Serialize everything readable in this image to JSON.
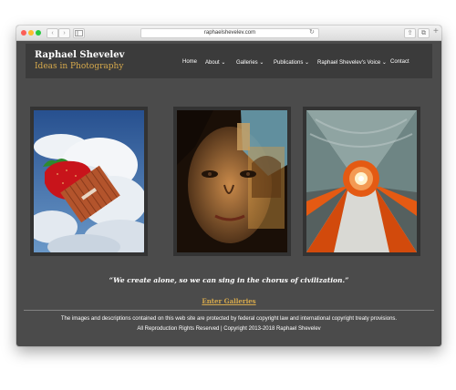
{
  "browser": {
    "url": "raphaelshevelev.com",
    "back_label": "‹",
    "forward_label": "›",
    "reload_label": "↻",
    "share_label": "⇪",
    "tabs_label": "⧉",
    "new_tab_label": "+"
  },
  "site": {
    "title": "Raphael Shevelev",
    "tagline": "Ideas in Photography"
  },
  "nav": {
    "items": [
      {
        "label": "Home"
      },
      {
        "label": "About ⌄"
      },
      {
        "label": "Galleries ⌄"
      },
      {
        "label": "Publications ⌄"
      },
      {
        "label": "Raphael Shevelev's Voice ⌄"
      },
      {
        "label": "Contact"
      }
    ]
  },
  "gallery": {
    "images": [
      {
        "name": "strawberry-container-photo",
        "icon": "strawberry-and-shipping-container"
      },
      {
        "name": "face-architecture-photo",
        "icon": "face-overlay-building"
      },
      {
        "name": "tunnel-photo",
        "icon": "orange-tunnel"
      }
    ]
  },
  "quote": "“We create alone, so we can sing in the chorus of civilization.”",
  "cta": "Enter Galleries",
  "footer": {
    "line1": "The images and descriptions contained on this web site are protected by federal copyright law and international copyright treaty provisions.",
    "line2": "All Reproduction Rights Reserved | Copyright 2013-2018 Raphael Shevelev"
  },
  "colors": {
    "page_bg": "#4b4b4b",
    "header_bg": "#3b3b3b",
    "accent": "#d6a94c"
  }
}
